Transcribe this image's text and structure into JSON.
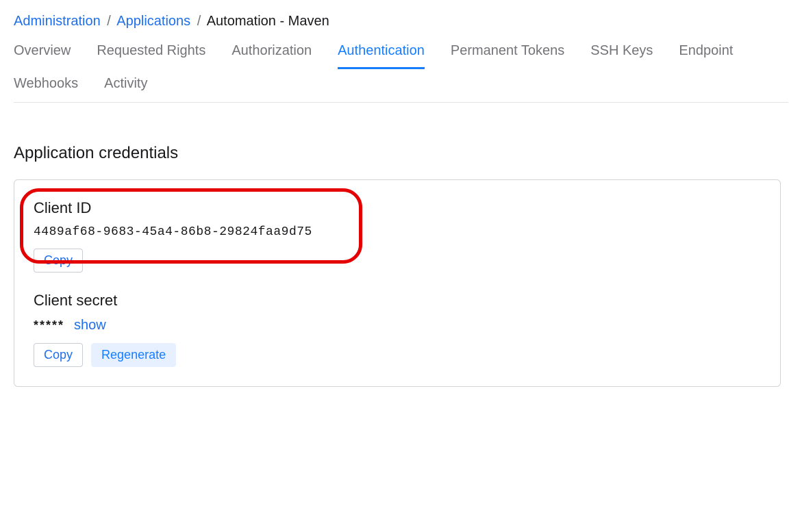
{
  "breadcrumb": {
    "items": [
      {
        "label": "Administration"
      },
      {
        "label": "Applications"
      }
    ],
    "current": "Automation - Maven",
    "sep": "/"
  },
  "tabs": [
    {
      "label": "Overview",
      "active": false
    },
    {
      "label": "Requested Rights",
      "active": false
    },
    {
      "label": "Authorization",
      "active": false
    },
    {
      "label": "Authentication",
      "active": true
    },
    {
      "label": "Permanent Tokens",
      "active": false
    },
    {
      "label": "SSH Keys",
      "active": false
    },
    {
      "label": "Endpoint",
      "active": false
    },
    {
      "label": "Webhooks",
      "active": false
    },
    {
      "label": "Activity",
      "active": false
    }
  ],
  "credentials": {
    "title": "Application credentials",
    "client_id_label": "Client ID",
    "client_id_value": "4489af68-9683-45a4-86b8-29824faa9d75",
    "client_secret_label": "Client secret",
    "client_secret_masked": "*****",
    "show_label": "show",
    "copy_label": "Copy",
    "regenerate_label": "Regenerate"
  }
}
